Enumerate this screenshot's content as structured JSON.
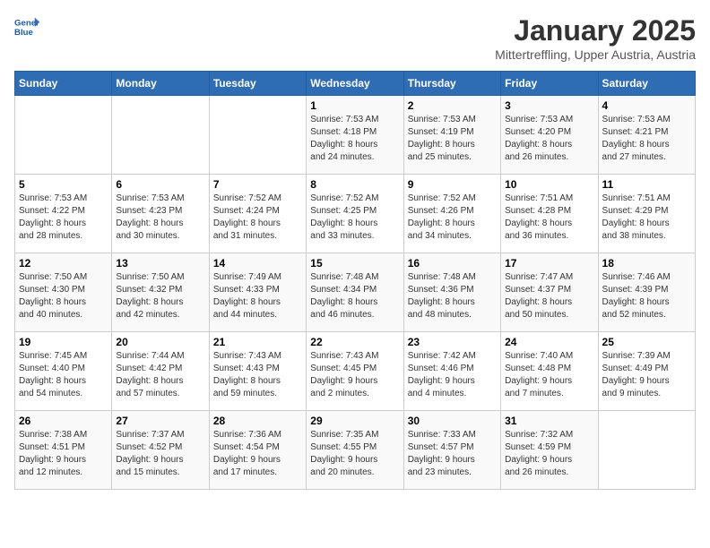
{
  "header": {
    "logo_line1": "General",
    "logo_line2": "Blue",
    "title": "January 2025",
    "subtitle": "Mittertreffling, Upper Austria, Austria"
  },
  "weekdays": [
    "Sunday",
    "Monday",
    "Tuesday",
    "Wednesday",
    "Thursday",
    "Friday",
    "Saturday"
  ],
  "weeks": [
    [
      {
        "num": "",
        "info": ""
      },
      {
        "num": "",
        "info": ""
      },
      {
        "num": "",
        "info": ""
      },
      {
        "num": "1",
        "info": "Sunrise: 7:53 AM\nSunset: 4:18 PM\nDaylight: 8 hours\nand 24 minutes."
      },
      {
        "num": "2",
        "info": "Sunrise: 7:53 AM\nSunset: 4:19 PM\nDaylight: 8 hours\nand 25 minutes."
      },
      {
        "num": "3",
        "info": "Sunrise: 7:53 AM\nSunset: 4:20 PM\nDaylight: 8 hours\nand 26 minutes."
      },
      {
        "num": "4",
        "info": "Sunrise: 7:53 AM\nSunset: 4:21 PM\nDaylight: 8 hours\nand 27 minutes."
      }
    ],
    [
      {
        "num": "5",
        "info": "Sunrise: 7:53 AM\nSunset: 4:22 PM\nDaylight: 8 hours\nand 28 minutes."
      },
      {
        "num": "6",
        "info": "Sunrise: 7:53 AM\nSunset: 4:23 PM\nDaylight: 8 hours\nand 30 minutes."
      },
      {
        "num": "7",
        "info": "Sunrise: 7:52 AM\nSunset: 4:24 PM\nDaylight: 8 hours\nand 31 minutes."
      },
      {
        "num": "8",
        "info": "Sunrise: 7:52 AM\nSunset: 4:25 PM\nDaylight: 8 hours\nand 33 minutes."
      },
      {
        "num": "9",
        "info": "Sunrise: 7:52 AM\nSunset: 4:26 PM\nDaylight: 8 hours\nand 34 minutes."
      },
      {
        "num": "10",
        "info": "Sunrise: 7:51 AM\nSunset: 4:28 PM\nDaylight: 8 hours\nand 36 minutes."
      },
      {
        "num": "11",
        "info": "Sunrise: 7:51 AM\nSunset: 4:29 PM\nDaylight: 8 hours\nand 38 minutes."
      }
    ],
    [
      {
        "num": "12",
        "info": "Sunrise: 7:50 AM\nSunset: 4:30 PM\nDaylight: 8 hours\nand 40 minutes."
      },
      {
        "num": "13",
        "info": "Sunrise: 7:50 AM\nSunset: 4:32 PM\nDaylight: 8 hours\nand 42 minutes."
      },
      {
        "num": "14",
        "info": "Sunrise: 7:49 AM\nSunset: 4:33 PM\nDaylight: 8 hours\nand 44 minutes."
      },
      {
        "num": "15",
        "info": "Sunrise: 7:48 AM\nSunset: 4:34 PM\nDaylight: 8 hours\nand 46 minutes."
      },
      {
        "num": "16",
        "info": "Sunrise: 7:48 AM\nSunset: 4:36 PM\nDaylight: 8 hours\nand 48 minutes."
      },
      {
        "num": "17",
        "info": "Sunrise: 7:47 AM\nSunset: 4:37 PM\nDaylight: 8 hours\nand 50 minutes."
      },
      {
        "num": "18",
        "info": "Sunrise: 7:46 AM\nSunset: 4:39 PM\nDaylight: 8 hours\nand 52 minutes."
      }
    ],
    [
      {
        "num": "19",
        "info": "Sunrise: 7:45 AM\nSunset: 4:40 PM\nDaylight: 8 hours\nand 54 minutes."
      },
      {
        "num": "20",
        "info": "Sunrise: 7:44 AM\nSunset: 4:42 PM\nDaylight: 8 hours\nand 57 minutes."
      },
      {
        "num": "21",
        "info": "Sunrise: 7:43 AM\nSunset: 4:43 PM\nDaylight: 8 hours\nand 59 minutes."
      },
      {
        "num": "22",
        "info": "Sunrise: 7:43 AM\nSunset: 4:45 PM\nDaylight: 9 hours\nand 2 minutes."
      },
      {
        "num": "23",
        "info": "Sunrise: 7:42 AM\nSunset: 4:46 PM\nDaylight: 9 hours\nand 4 minutes."
      },
      {
        "num": "24",
        "info": "Sunrise: 7:40 AM\nSunset: 4:48 PM\nDaylight: 9 hours\nand 7 minutes."
      },
      {
        "num": "25",
        "info": "Sunrise: 7:39 AM\nSunset: 4:49 PM\nDaylight: 9 hours\nand 9 minutes."
      }
    ],
    [
      {
        "num": "26",
        "info": "Sunrise: 7:38 AM\nSunset: 4:51 PM\nDaylight: 9 hours\nand 12 minutes."
      },
      {
        "num": "27",
        "info": "Sunrise: 7:37 AM\nSunset: 4:52 PM\nDaylight: 9 hours\nand 15 minutes."
      },
      {
        "num": "28",
        "info": "Sunrise: 7:36 AM\nSunset: 4:54 PM\nDaylight: 9 hours\nand 17 minutes."
      },
      {
        "num": "29",
        "info": "Sunrise: 7:35 AM\nSunset: 4:55 PM\nDaylight: 9 hours\nand 20 minutes."
      },
      {
        "num": "30",
        "info": "Sunrise: 7:33 AM\nSunset: 4:57 PM\nDaylight: 9 hours\nand 23 minutes."
      },
      {
        "num": "31",
        "info": "Sunrise: 7:32 AM\nSunset: 4:59 PM\nDaylight: 9 hours\nand 26 minutes."
      },
      {
        "num": "",
        "info": ""
      }
    ]
  ]
}
